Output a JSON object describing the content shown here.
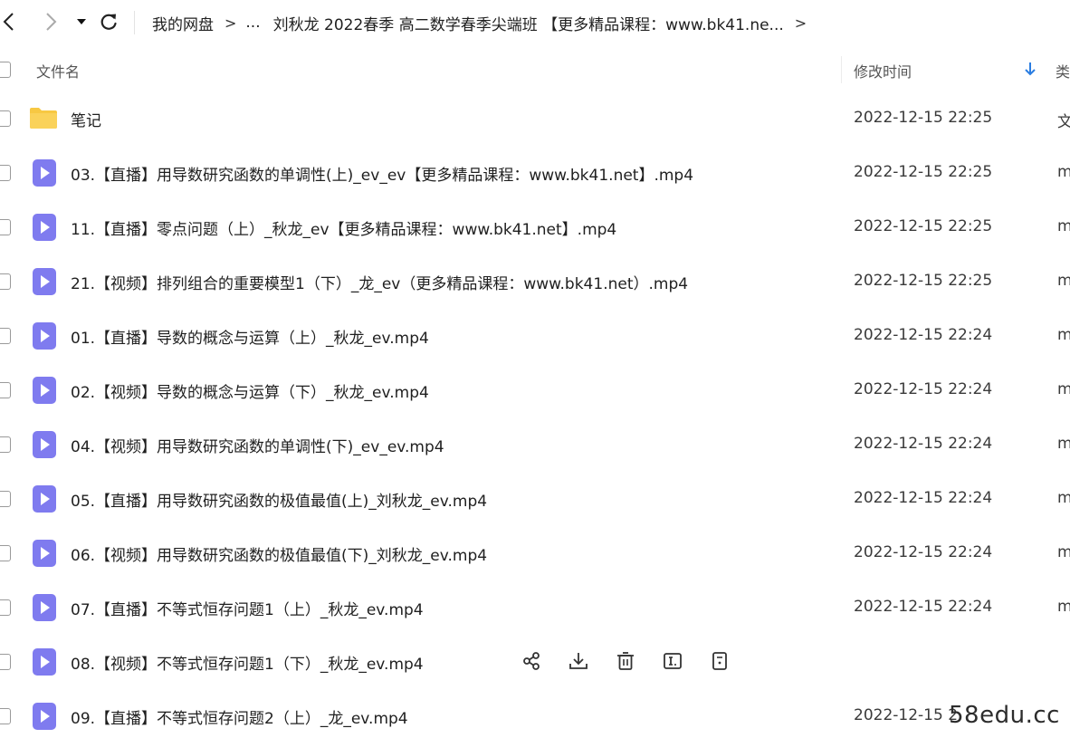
{
  "breadcrumb": {
    "root": "我的网盘",
    "separator": ">",
    "ellipsis": "...",
    "current": "刘秋龙 2022春季 高二数学春季尖端班 【更多精品课程：www.bk41.ne...",
    "trailing": ">"
  },
  "columns": {
    "name": "文件名",
    "modified": "修改时间",
    "type": "类"
  },
  "colors": {
    "folder": "#F7C843",
    "video": "#7F7BEF",
    "sort_arrow": "#2A7DE1"
  },
  "files": [
    {
      "name": "笔记",
      "time": "2022-12-15 22:25",
      "type": "文",
      "icon": "folder-icon"
    },
    {
      "name": "03.【直播】用导数研究函数的单调性(上)_ev_ev【更多精品课程：www.bk41.net】.mp4",
      "time": "2022-12-15 22:25",
      "type": "m",
      "icon": "video-file-icon"
    },
    {
      "name": "11.【直播】零点问题（上）_秋龙_ev【更多精品课程：www.bk41.net】.mp4",
      "time": "2022-12-15 22:25",
      "type": "m",
      "icon": "video-file-icon"
    },
    {
      "name": "21.【视频】排列组合的重要模型1（下）_龙_ev（更多精品课程：www.bk41.net）.mp4",
      "time": "2022-12-15 22:25",
      "type": "m",
      "icon": "video-file-icon"
    },
    {
      "name": "01.【直播】导数的概念与运算（上）_秋龙_ev.mp4",
      "time": "2022-12-15 22:24",
      "type": "m",
      "icon": "video-file-icon"
    },
    {
      "name": "02.【视频】导数的概念与运算（下）_秋龙_ev.mp4",
      "time": "2022-12-15 22:24",
      "type": "m",
      "icon": "video-file-icon"
    },
    {
      "name": "04.【视频】用导数研究函数的单调性(下)_ev_ev.mp4",
      "time": "2022-12-15 22:24",
      "type": "m",
      "icon": "video-file-icon"
    },
    {
      "name": "05.【直播】用导数研究函数的极值最值(上)_刘秋龙_ev.mp4",
      "time": "2022-12-15 22:24",
      "type": "m",
      "icon": "video-file-icon"
    },
    {
      "name": "06.【视频】用导数研究函数的极值最值(下)_刘秋龙_ev.mp4",
      "time": "2022-12-15 22:24",
      "type": "m",
      "icon": "video-file-icon"
    },
    {
      "name": "07.【直播】不等式恒存问题1（上）_秋龙_ev.mp4",
      "time": "2022-12-15 22:24",
      "type": "m",
      "icon": "video-file-icon"
    },
    {
      "name": "08.【视频】不等式恒存问题1（下）_秋龙_ev.mp4",
      "time": "",
      "type": "",
      "icon": "video-file-icon",
      "hover": true
    },
    {
      "name": "09.【直播】不等式恒存问题2（上）_龙_ev.mp4",
      "time": "2022-12-15 2",
      "type": "",
      "icon": "video-file-icon"
    }
  ],
  "hover_actions": [
    "share-icon",
    "download-icon",
    "delete-icon",
    "rename-icon",
    "more-icon"
  ],
  "watermark": "58edu.cc"
}
